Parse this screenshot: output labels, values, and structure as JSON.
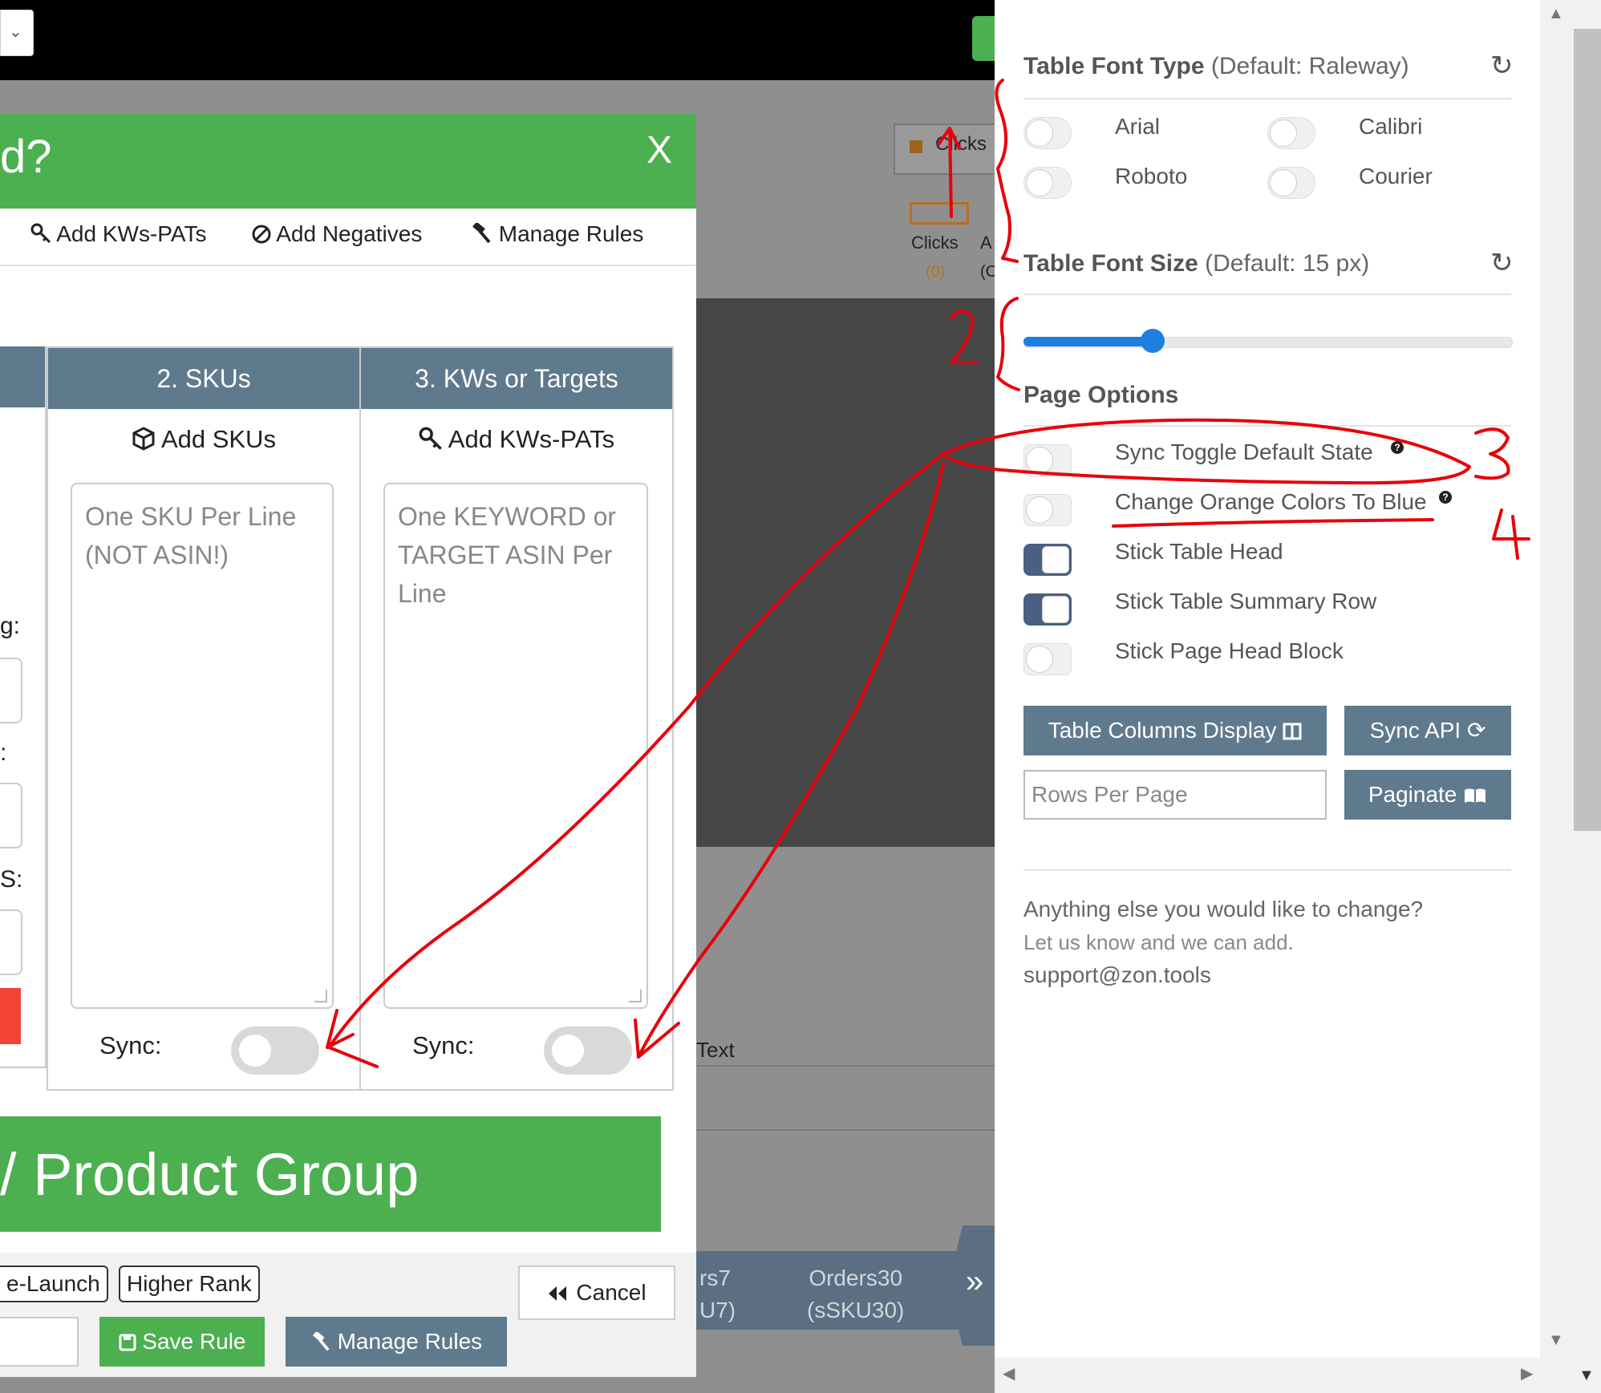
{
  "modal": {
    "title_fragment": "d?",
    "close_label": "X",
    "tabs": [
      {
        "icon": "key-search-icon",
        "label": "Add KWs-PATs"
      },
      {
        "icon": "ban-icon",
        "label": "Add Negatives"
      },
      {
        "icon": "gavel-icon",
        "label": "Manage Rules"
      }
    ],
    "columns": [
      {
        "header": "2. SKUs",
        "action_icon": "cube-icon",
        "action_label": "Add SKUs",
        "placeholder": "One SKU Per Line (NOT ASIN!)",
        "sync_label": "Sync:"
      },
      {
        "header": "3. KWs or Targets",
        "action_icon": "key-search-icon",
        "action_label": "Add KWs-PATs",
        "placeholder": "One KEYWORD or TARGET ASIN Per Line",
        "sync_label": "Sync:"
      }
    ],
    "left_label_fragments": [
      "g:",
      ":",
      "S:"
    ],
    "banner_fragment": "/ Product Group",
    "chips": [
      "e-Launch",
      "Higher Rank"
    ],
    "cancel_label": "Cancel",
    "save_label": "Save Rule",
    "manage_label": "Manage Rules"
  },
  "background": {
    "legend_label": "Clicks",
    "clicks_header": "Clicks",
    "clicks_value": "(0)",
    "col2_header": "A",
    "col2_value": "(C",
    "text_label": "Text",
    "bottom_col1": [
      "rs7",
      "U7)"
    ],
    "bottom_col2": [
      "Orders30",
      "(sSKU30)"
    ],
    "chevron_glyph": "»",
    "top_select_glyph": "⌄"
  },
  "settings": {
    "font_type": {
      "title": "Table Font Type",
      "default_note": "(Default: Raleway)",
      "options": [
        "Arial",
        "Calibri",
        "Roboto",
        "Courier"
      ]
    },
    "font_size": {
      "title": "Table Font Size",
      "default_note": "(Default: 15 px)",
      "slider_fraction": 0.2
    },
    "page_options": {
      "title": "Page Options",
      "options": [
        {
          "label": "Sync Toggle Default State",
          "on": false,
          "help": true
        },
        {
          "label": "Change Orange Colors To Blue",
          "on": false,
          "help": true
        },
        {
          "label": "Stick Table Head",
          "on": true,
          "help": false
        },
        {
          "label": "Stick Table Summary Row",
          "on": true,
          "help": false
        },
        {
          "label": "Stick Page Head Block",
          "on": false,
          "help": false
        }
      ]
    },
    "buttons": {
      "columns_display": "Table Columns Display",
      "sync_api": "Sync API",
      "rows_placeholder": "Rows Per Page",
      "paginate": "Paginate"
    },
    "note": {
      "question": "Anything else you would like to change?",
      "line2": "Let us know and we can add.",
      "email": "support@zon.tools"
    }
  },
  "annotations": {
    "numbers": [
      "1",
      "2",
      "3",
      "4"
    ],
    "color": "#e8000b"
  },
  "colors": {
    "green": "#4caf50",
    "slate": "#5f7a8c",
    "toggle_on": "#4b5f82",
    "slider": "#1e7fe0",
    "danger": "#f44336",
    "orange": "#b9701f"
  }
}
